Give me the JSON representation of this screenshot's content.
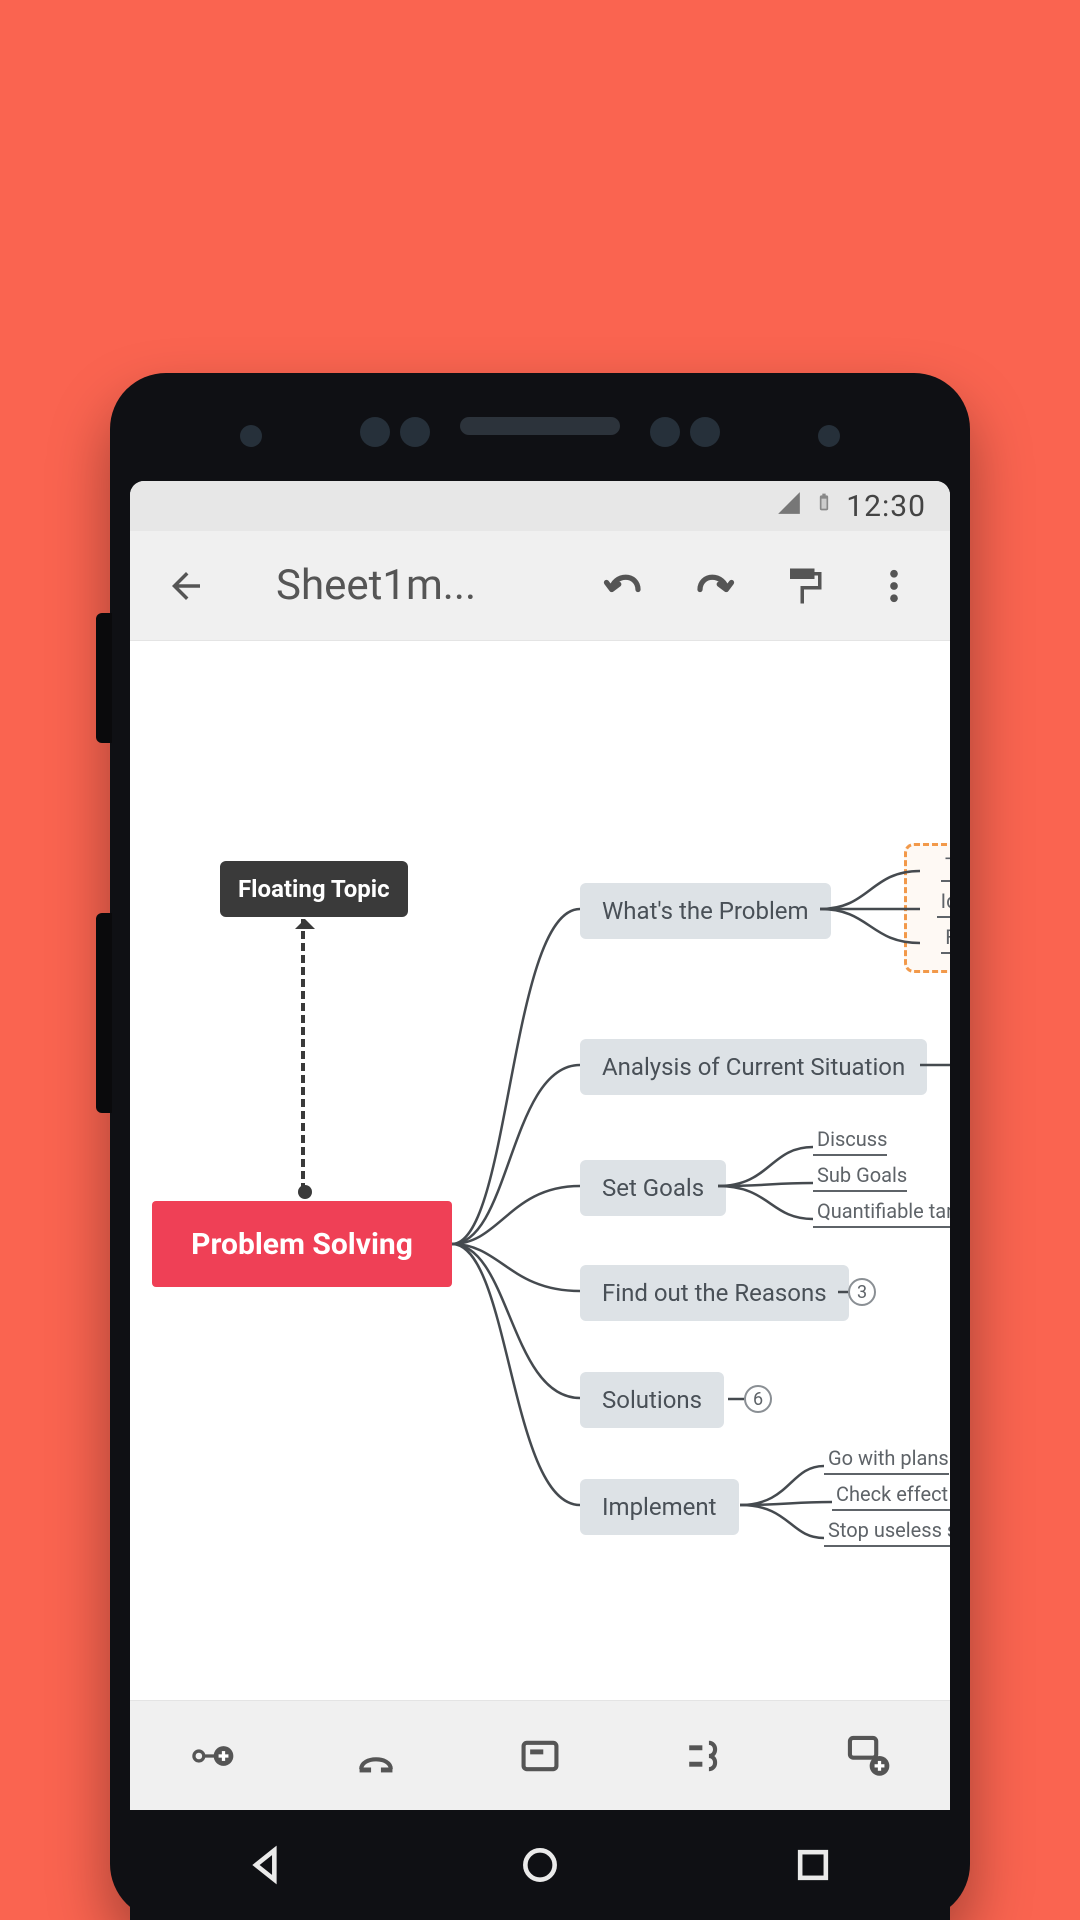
{
  "status": {
    "time": "12:30"
  },
  "toolbar": {
    "title": "Sheet1m..."
  },
  "mindmap": {
    "floating_topic_label": "Floating Topic",
    "root_label": "Problem Solving",
    "branches": {
      "b1": {
        "label": "What's the Problem"
      },
      "b2": {
        "label": "Analysis of Current Situation"
      },
      "b3": {
        "label": "Set Goals"
      },
      "b4": {
        "label": "Find out the Reasons",
        "badge": "3"
      },
      "b5": {
        "label": "Solutions",
        "badge": "6"
      },
      "b6": {
        "label": "Implement"
      }
    },
    "leaves": {
      "b1": {
        "a": "Th",
        "b": "Ide",
        "c": "Fir"
      },
      "b3": {
        "a": "Discuss",
        "b": "Sub Goals",
        "c": "Quantifiable targe"
      },
      "b6": {
        "a": "Go with plans",
        "b": "Check effect of",
        "c": "Stop useless so"
      }
    }
  },
  "icons": {
    "back": "back-arrow",
    "undo": "undo",
    "redo": "redo",
    "format": "format-paint",
    "more": "more-vertical",
    "add_node": "add-node",
    "relation": "relationship",
    "note": "note",
    "summary": "summary",
    "add_floating": "add-floating"
  },
  "colors": {
    "bg": "#fa6450",
    "root": "#ef4056",
    "branch": "#dde2e6",
    "floating": "#3a3a3a",
    "callout_border": "#f2994a"
  }
}
